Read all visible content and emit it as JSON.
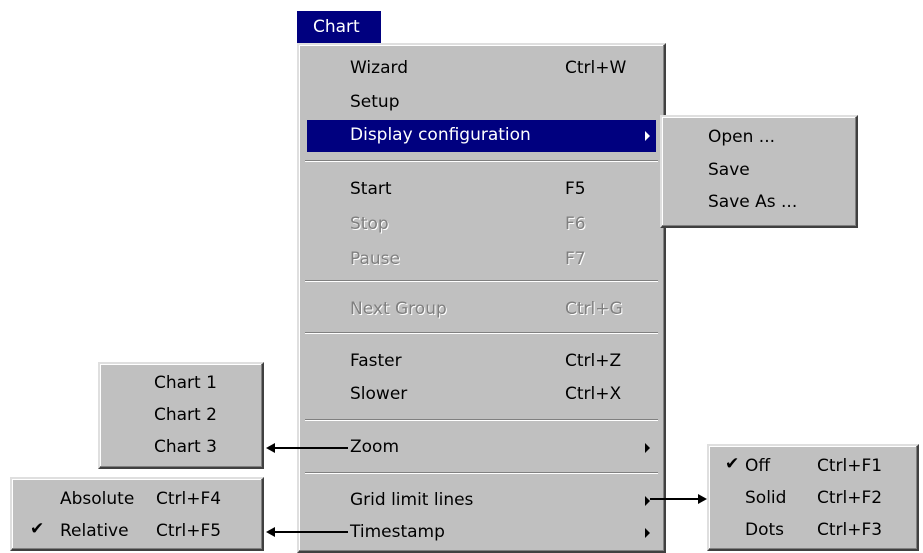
{
  "menubar": {
    "chart": "Chart"
  },
  "main_menu": {
    "wizard": {
      "label": "Wizard",
      "shortcut": "Ctrl+W"
    },
    "setup": {
      "label": "Setup"
    },
    "display_configuration": {
      "label": "Display configuration"
    },
    "start": {
      "label": "Start",
      "shortcut": "F5"
    },
    "stop": {
      "label": "Stop",
      "shortcut": "F6"
    },
    "pause": {
      "label": "Pause",
      "shortcut": "F7"
    },
    "next_group": {
      "label": "Next Group",
      "shortcut": "Ctrl+G"
    },
    "faster": {
      "label": "Faster",
      "shortcut": "Ctrl+Z"
    },
    "slower": {
      "label": "Slower",
      "shortcut": "Ctrl+X"
    },
    "zoom": {
      "label": "Zoom"
    },
    "grid_limit_lines": {
      "label": "Grid limit lines"
    },
    "timestamp": {
      "label": "Timestamp"
    }
  },
  "display_submenu": {
    "open": {
      "label": "Open ..."
    },
    "save": {
      "label": "Save"
    },
    "save_as": {
      "label": "Save As ..."
    }
  },
  "zoom_submenu": {
    "chart1": {
      "label": "Chart 1"
    },
    "chart2": {
      "label": "Chart 2"
    },
    "chart3": {
      "label": "Chart 3"
    }
  },
  "timestamp_submenu": {
    "absolute": {
      "label": "Absolute",
      "shortcut": "Ctrl+F4"
    },
    "relative": {
      "label": "Relative",
      "shortcut": "Ctrl+F5",
      "checked": true
    }
  },
  "grid_submenu": {
    "off": {
      "label": "Off",
      "shortcut": "Ctrl+F1",
      "checked": true
    },
    "solid": {
      "label": "Solid",
      "shortcut": "Ctrl+F2"
    },
    "dots": {
      "label": "Dots",
      "shortcut": "Ctrl+F3"
    }
  },
  "icons": {
    "check": "✔",
    "submenu_arrow": "submenu-arrow-icon"
  },
  "colors": {
    "menu_bg": "#c0c0c0",
    "highlight": "#00007f",
    "disabled": "#808080"
  }
}
